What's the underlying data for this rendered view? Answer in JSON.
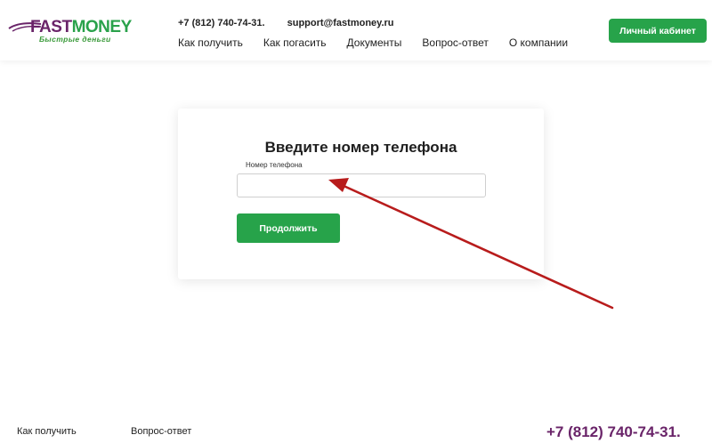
{
  "header": {
    "logo": {
      "brand_part1": "FAST",
      "brand_part2": "MONEY",
      "tagline": "Быстрые деньги"
    },
    "phone": "+7 (812) 740-74-31.",
    "email": "support@fastmoney.ru",
    "nav": [
      {
        "label": "Как получить"
      },
      {
        "label": "Как погасить"
      },
      {
        "label": "Документы"
      },
      {
        "label": "Вопрос-ответ"
      },
      {
        "label": "О компании"
      }
    ],
    "cabinet_button": "Личный кабинет"
  },
  "form": {
    "title": "Введите номер телефона",
    "field_label": "Номер телефона",
    "input_value": "",
    "input_placeholder": "",
    "submit_label": "Продолжить"
  },
  "footer": {
    "links": [
      {
        "label": "Как получить"
      },
      {
        "label": "Вопрос-ответ"
      }
    ],
    "phone": "+7 (812) 740-74-31."
  },
  "colors": {
    "brand_purple": "#6a2469",
    "brand_green": "#27a34a",
    "annotation_arrow": "#b81c1c"
  },
  "icons": {
    "annotation": "arrow-pointer-icon"
  }
}
